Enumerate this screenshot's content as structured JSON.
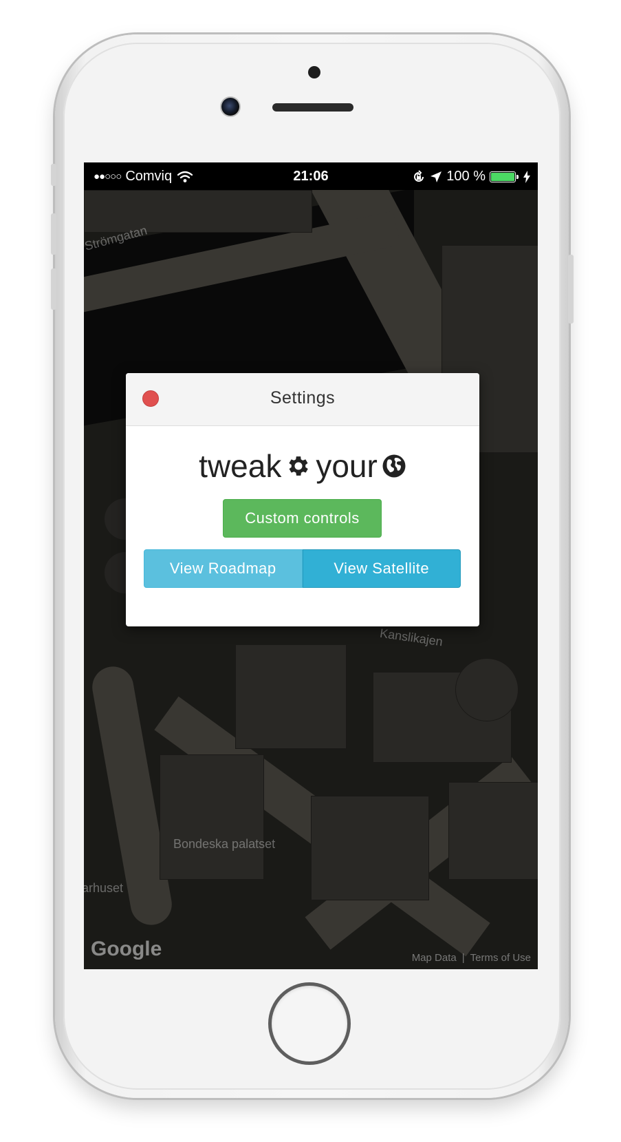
{
  "status_bar": {
    "signal": "●●○○○",
    "carrier": "Comviq",
    "time": "21:06",
    "battery_percent": "100 %",
    "battery_level": 1.0
  },
  "map": {
    "labels": [
      "Bondeska palatset",
      "Kanslikajen",
      "Strömgatan",
      "Riddarhuset"
    ],
    "google_logo": "Google",
    "map_data": "Map Data",
    "separator": "|",
    "terms": "Terms of Use"
  },
  "modal": {
    "title": "Settings",
    "brand_word1": "tweak",
    "brand_word2": "your",
    "custom_controls": "Custom controls",
    "view_roadmap": "View Roadmap",
    "view_satellite": "View Satellite"
  },
  "colors": {
    "close": "#e0504f",
    "success": "#5cb85c",
    "info": "#5bc0de",
    "info_active": "#31b0d5"
  }
}
